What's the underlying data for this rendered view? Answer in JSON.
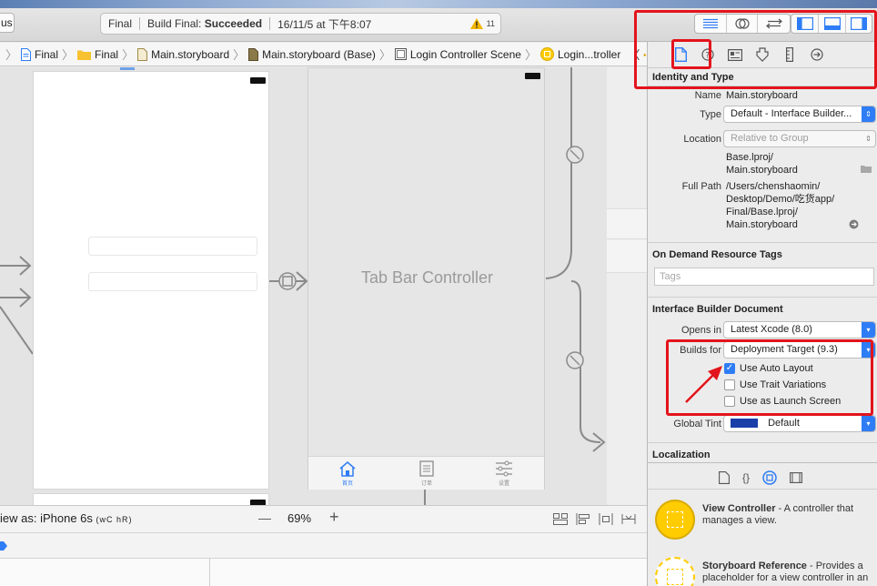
{
  "toolbar": {
    "scheme": "us",
    "status": {
      "project": "Final",
      "build_prefix": "Build Final:",
      "build_result": "Succeeded",
      "timestamp": "16/11/5 at 下午8:07",
      "warning_count": "11"
    }
  },
  "jumpbar": {
    "crumbs": [
      "Final",
      "Final",
      "Main.storyboard",
      "Main.storyboard (Base)",
      "Login Controller Scene",
      "Login...troller"
    ]
  },
  "canvas": {
    "tab_bar_title": "Tab Bar Controller",
    "tabs": [
      "首页",
      "订单",
      "设置"
    ]
  },
  "bottombar": {
    "view_as": "iew as: iPhone 6s",
    "size_class": "(wC hR)",
    "zoom_minus": "—",
    "zoom": "69%",
    "zoom_plus": "+"
  },
  "inspector": {
    "identity": {
      "header": "Identity and Type",
      "name_label": "Name",
      "name_value": "Main.storyboard",
      "type_label": "Type",
      "type_value": "Default - Interface Builder...",
      "location_label": "Location",
      "location_value": "Relative to Group",
      "location_path_1": "Base.lproj/",
      "location_path_2": "Main.storyboard",
      "fullpath_label": "Full Path",
      "fullpath_1": "/Users/chenshaomin/",
      "fullpath_2": "Desktop/Demo/吃货app/",
      "fullpath_3": "Final/Base.lproj/",
      "fullpath_4": "Main.storyboard"
    },
    "tags": {
      "header": "On Demand Resource Tags",
      "placeholder": "Tags"
    },
    "ib_document": {
      "header": "Interface Builder Document",
      "opens_in_label": "Opens in",
      "opens_in_value": "Latest Xcode (8.0)",
      "builds_for_label": "Builds for",
      "builds_for_value": "Deployment Target (9.3)",
      "use_auto_layout": "Use Auto Layout",
      "use_trait_variations": "Use Trait Variations",
      "use_launch_screen": "Use as Launch Screen",
      "global_tint_label": "Global Tint",
      "global_tint_value": "Default"
    },
    "localization": {
      "header": "Localization"
    },
    "library": [
      {
        "title": "View Controller",
        "desc": " - A controller that manages a view."
      },
      {
        "title": "Storyboard Reference",
        "desc": " - Provides a placeholder for a view controller in an"
      }
    ]
  },
  "colors": {
    "accent": "#2f7df6",
    "highlight": "#e3141b",
    "library_icon": "#ffcc00"
  }
}
